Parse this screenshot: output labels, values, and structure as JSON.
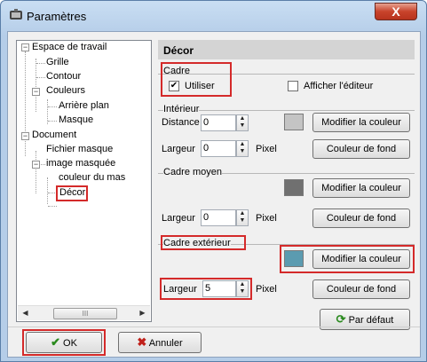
{
  "window": {
    "title": "Paramètres",
    "close_label": "X"
  },
  "tree": {
    "items": [
      {
        "label": "Espace de travail",
        "expanded": true
      },
      {
        "label": "Grille"
      },
      {
        "label": "Contour"
      },
      {
        "label": "Couleurs",
        "expanded": true
      },
      {
        "label": "Arrière plan"
      },
      {
        "label": "Masque"
      },
      {
        "label": "Document",
        "expanded": true
      },
      {
        "label": "Fichier masque"
      },
      {
        "label": "image masquée",
        "expanded": true
      },
      {
        "label": "couleur du mas"
      },
      {
        "label": "Décor",
        "selected": true
      }
    ],
    "scroll_thumb_label": "III"
  },
  "panel": {
    "header": "Décor",
    "cadre": {
      "label": "Cadre",
      "utiliser_label": "Utiliser",
      "utiliser_checked": true,
      "editor_label": "Afficher l'éditeur",
      "editor_checked": false
    },
    "interieur": {
      "label": "Intérieur",
      "distance_label": "Distance",
      "distance_value": "0",
      "largeur_label": "Largeur",
      "largeur_value": "0",
      "unit": "Pixel",
      "swatch_color": "#c4c4c4",
      "modify_label": "Modifier la couleur",
      "background_label": "Couleur de fond"
    },
    "cadre_moyen": {
      "label": "Cadre moyen",
      "largeur_label": "Largeur",
      "largeur_value": "0",
      "unit": "Pixel",
      "swatch_color": "#707070",
      "modify_label": "Modifier la couleur",
      "background_label": "Couleur de fond"
    },
    "cadre_exterieur": {
      "label": "Cadre extérieur",
      "largeur_label": "Largeur",
      "largeur_value": "5",
      "unit": "Pixel",
      "swatch_color": "#5b9bb0",
      "modify_label": "Modifier la couleur",
      "background_label": "Couleur de fond"
    },
    "default_label": "Par défaut"
  },
  "footer": {
    "ok_label": "OK",
    "cancel_label": "Annuler"
  },
  "colors": {
    "highlight_red": "#d42a2a",
    "ok_green": "#2a8a1e",
    "cancel_red": "#c0201a"
  }
}
